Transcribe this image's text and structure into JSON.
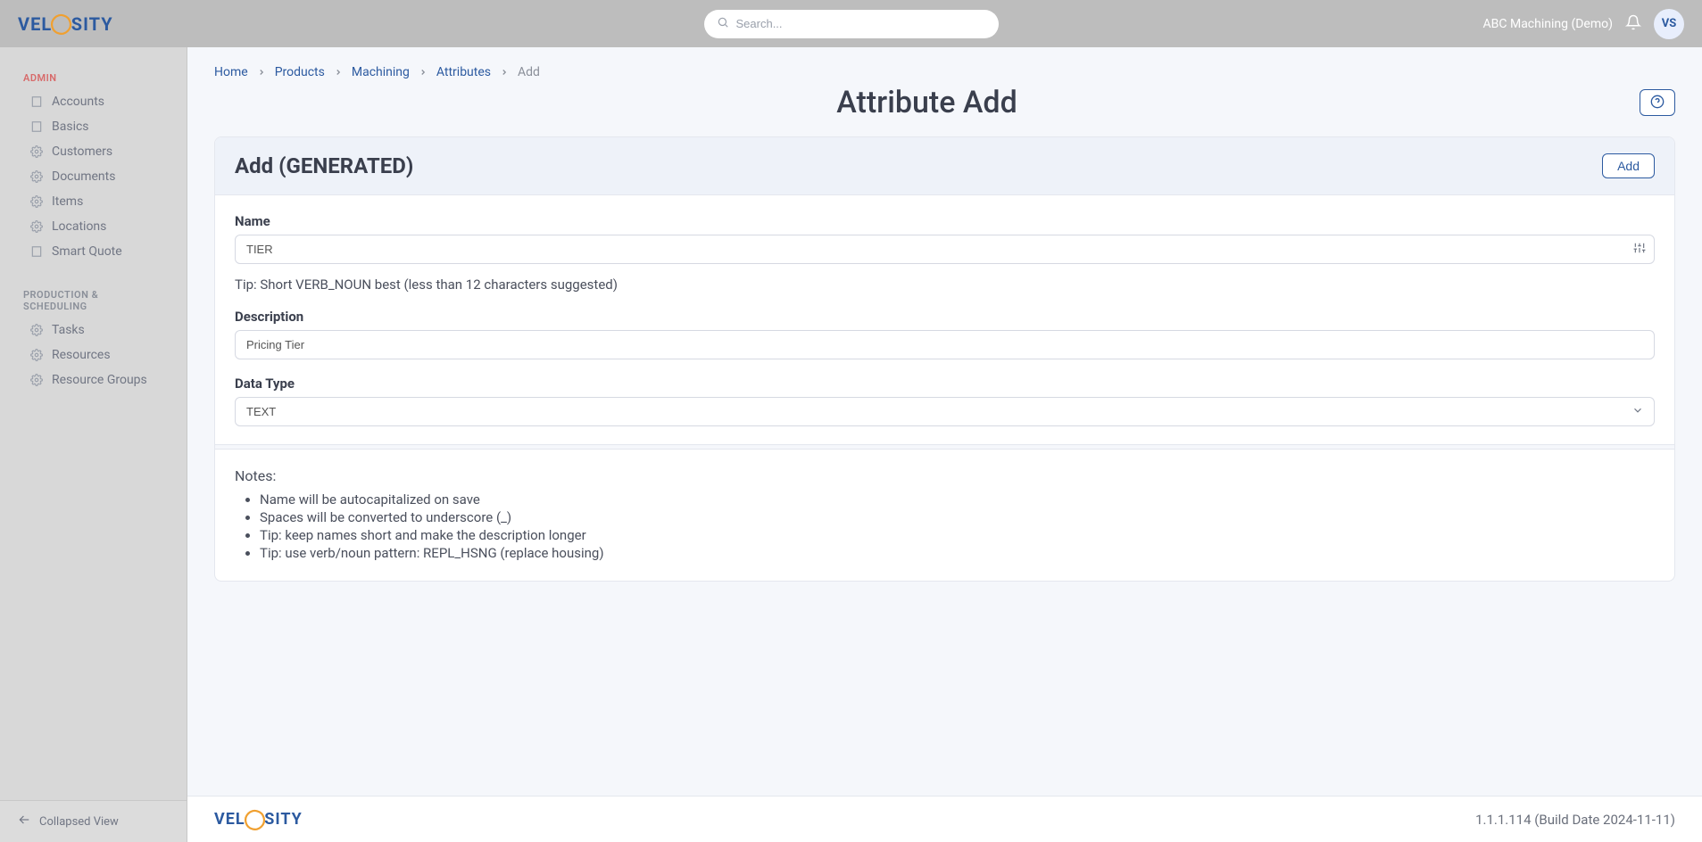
{
  "brand": {
    "left": "VEL",
    "right": "SITY"
  },
  "search": {
    "placeholder": "Search..."
  },
  "header": {
    "account_label": "ABC Machining (Demo)",
    "avatar_initials": "VS"
  },
  "sidebar": {
    "sections": [
      {
        "label": "ADMIN",
        "class": "admin",
        "items": [
          {
            "label": "Accounts",
            "icon": "building-icon"
          },
          {
            "label": "Basics",
            "icon": "building-icon"
          },
          {
            "label": "Customers",
            "icon": "gear-icon"
          },
          {
            "label": "Documents",
            "icon": "gear-icon"
          },
          {
            "label": "Items",
            "icon": "gear-icon"
          },
          {
            "label": "Locations",
            "icon": "gear-icon"
          },
          {
            "label": "Smart Quote",
            "icon": "building-icon"
          }
        ]
      },
      {
        "label": "PRODUCTION & SCHEDULING",
        "class": "",
        "items": [
          {
            "label": "Tasks",
            "icon": "gear-icon"
          },
          {
            "label": "Resources",
            "icon": "gear-icon"
          },
          {
            "label": "Resource Groups",
            "icon": "gear-icon"
          }
        ]
      }
    ],
    "collapse_label": "Collapsed View"
  },
  "breadcrumb": {
    "items": [
      "Home",
      "Products",
      "Machining",
      "Attributes"
    ],
    "current": "Add"
  },
  "page": {
    "title": "Attribute Add",
    "card_title": "Add (GENERATED)",
    "add_button": "Add"
  },
  "form": {
    "name_label": "Name",
    "name_value": "TIER",
    "name_tip": "Tip: Short VERB_NOUN best (less than 12 characters suggested)",
    "description_label": "Description",
    "description_value": "Pricing Tier",
    "data_type_label": "Data Type",
    "data_type_value": "TEXT"
  },
  "notes": {
    "heading": "Notes:",
    "items": [
      "Name will be autocapitalized on save",
      "Spaces will be converted to underscore (_)",
      "Tip: keep names short and make the description longer",
      "Tip: use verb/noun pattern: REPL_HSNG (replace housing)"
    ]
  },
  "footer": {
    "version": "1.1.1.114 (Build Date 2024-11-11)"
  }
}
